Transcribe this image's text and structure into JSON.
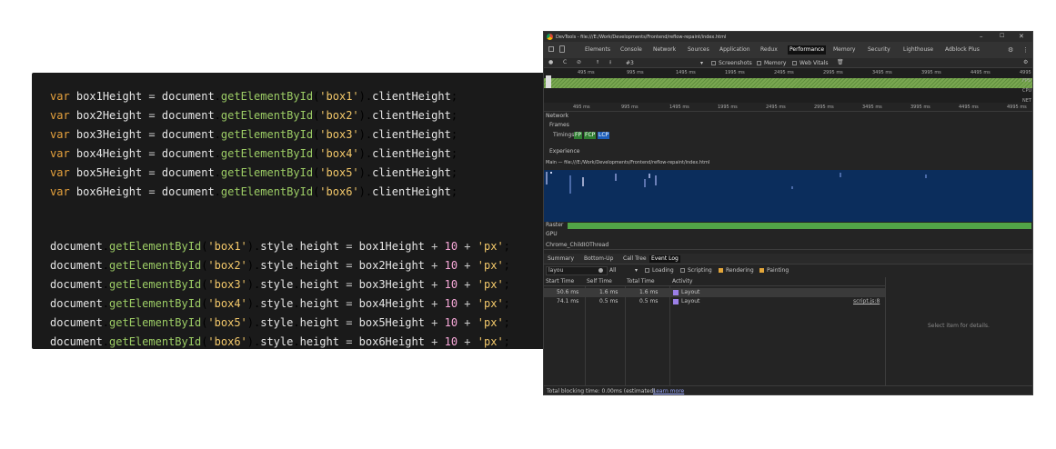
{
  "code_lines_1": [
    {
      "kw": "var",
      "name": "box1Height",
      "eq": "=",
      "doc": "document",
      "fn": "getElementById",
      "arg": "'box1'",
      "prop": "clientHeight"
    },
    {
      "kw": "var",
      "name": "box2Height",
      "eq": "=",
      "doc": "document",
      "fn": "getElementById",
      "arg": "'box2'",
      "prop": "clientHeight"
    },
    {
      "kw": "var",
      "name": "box3Height",
      "eq": "=",
      "doc": "document",
      "fn": "getElementById",
      "arg": "'box3'",
      "prop": "clientHeight"
    },
    {
      "kw": "var",
      "name": "box4Height",
      "eq": "=",
      "doc": "document",
      "fn": "getElementById",
      "arg": "'box4'",
      "prop": "clientHeight"
    },
    {
      "kw": "var",
      "name": "box5Height",
      "eq": "=",
      "doc": "document",
      "fn": "getElementById",
      "arg": "'box5'",
      "prop": "clientHeight"
    },
    {
      "kw": "var",
      "name": "box6Height",
      "eq": "=",
      "doc": "document",
      "fn": "getElementById",
      "arg": "'box6'",
      "prop": "clientHeight"
    }
  ],
  "code_lines_2": [
    {
      "doc": "document",
      "fn": "getElementById",
      "arg": "'box1'",
      "style": "style",
      "height": "height",
      "eq": "=",
      "var": "box1Height",
      "plus": "+",
      "num": "10",
      "unit": "'px'"
    },
    {
      "doc": "document",
      "fn": "getElementById",
      "arg": "'box2'",
      "style": "style",
      "height": "height",
      "eq": "=",
      "var": "box2Height",
      "plus": "+",
      "num": "10",
      "unit": "'px'"
    },
    {
      "doc": "document",
      "fn": "getElementById",
      "arg": "'box3'",
      "style": "style",
      "height": "height",
      "eq": "=",
      "var": "box3Height",
      "plus": "+",
      "num": "10",
      "unit": "'px'"
    },
    {
      "doc": "document",
      "fn": "getElementById",
      "arg": "'box4'",
      "style": "style",
      "height": "height",
      "eq": "=",
      "var": "box4Height",
      "plus": "+",
      "num": "10",
      "unit": "'px'"
    },
    {
      "doc": "document",
      "fn": "getElementById",
      "arg": "'box5'",
      "style": "style",
      "height": "height",
      "eq": "=",
      "var": "box5Height",
      "plus": "+",
      "num": "10",
      "unit": "'px'"
    },
    {
      "doc": "document",
      "fn": "getElementById",
      "arg": "'box6'",
      "style": "style",
      "height": "height",
      "eq": "=",
      "var": "box6Height",
      "plus": "+",
      "num": "10",
      "unit": "'px'"
    }
  ],
  "devtools": {
    "title": "DevTools - file:///E:/Work/Developments/Frontend/reflow-repaint/index.html",
    "win_minimize": "–",
    "win_maximize": "☐",
    "win_close": "✕",
    "tabs": [
      "Elements",
      "Console",
      "Network",
      "Sources",
      "Application",
      "Redux",
      "Performance",
      "Memory",
      "Security",
      "Lighthouse",
      "Adblock Plus"
    ],
    "active_tab": "Performance",
    "toolbar": {
      "record": "●",
      "reload": "C",
      "clear": "⊘",
      "upload": "⭱",
      "download": "⭳",
      "profile": "#3",
      "dropdown": "▾",
      "screenshots": "Screenshots",
      "memory": "Memory",
      "web_vitals": "Web Vitals",
      "trash": "🗑",
      "settings": "⚙",
      "more": "⋮"
    },
    "overview_ticks": [
      "495 ms",
      "995 ms",
      "1495 ms",
      "1995 ms",
      "2495 ms",
      "2995 ms",
      "3495 ms",
      "3995 ms",
      "4495 ms",
      "4995 ms"
    ],
    "overview_labels": [
      "FPS",
      "CPU",
      "NET"
    ],
    "main_ticks": [
      "495 ms",
      "995 ms",
      "1495 ms",
      "1995 ms",
      "2495 ms",
      "2995 ms",
      "3495 ms",
      "3995 ms",
      "4495 ms",
      "4995 ms"
    ],
    "tracks": {
      "network": "Network",
      "frames": "Frames",
      "timings": "Timings",
      "fp": "FP",
      "fcp": "FCP",
      "lcp": "LCP",
      "experience": "Experience",
      "main": "Main — file:///E:/Work/Developments/Frontend/reflow-repaint/index.html",
      "raster": "Raster",
      "gpu": "GPU",
      "child": "Chrome_ChildIOThread"
    },
    "bottom_tabs": [
      "Summary",
      "Bottom-Up",
      "Call Tree",
      "Event Log"
    ],
    "active_bottom_tab": "Event Log",
    "filter": {
      "value": "layou",
      "all": "All",
      "loading": "Loading",
      "scripting": "Scripting",
      "rendering": "Rendering",
      "painting": "Painting"
    },
    "table_headers": [
      "Start Time",
      "Self Time",
      "Total Time",
      "Activity"
    ],
    "rows": [
      {
        "start": "50.6 ms",
        "self": "1.6 ms",
        "total": "1.6 ms",
        "activity": "Layout",
        "link": ""
      },
      {
        "start": "74.1 ms",
        "self": "0.5 ms",
        "total": "0.5 ms",
        "activity": "Layout",
        "link": "script.js:8"
      }
    ],
    "details": "Select item for details.",
    "footer_prefix": "Total blocking time: 0.00ms (estimated)",
    "footer_link": "Learn more",
    "colors": {
      "accent": "#4a8af4",
      "main_bg": "#0b2d5c",
      "raster": "#52a447",
      "layout": "#9b7fe6",
      "fps": "#6fa94a",
      "highlight": "#e3b341"
    }
  }
}
